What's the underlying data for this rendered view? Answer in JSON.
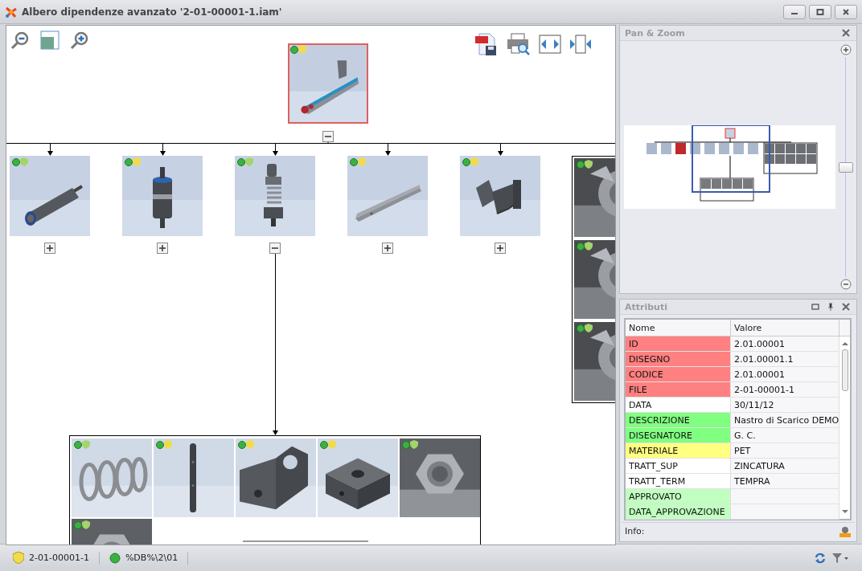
{
  "window": {
    "title": "Albero dipendenze avanzato '2-01-00001-1.iam'"
  },
  "tree": {
    "root": {
      "color": "#f0dc4a",
      "selected": true,
      "expanded": true
    },
    "children": [
      {
        "color": "#a5d46a",
        "selected": false,
        "expanded": false
      },
      {
        "color": "#f0dc4a",
        "selected": false,
        "expanded": false
      },
      {
        "color": "#a5d46a",
        "selected": false,
        "expanded": true
      },
      {
        "color": "#f0dc4a",
        "selected": false,
        "expanded": false
      },
      {
        "color": "#f0dc4a",
        "selected": false,
        "expanded": false
      }
    ],
    "side_group": [
      {
        "color": "#a5d46a"
      },
      {
        "color": "#a5d46a"
      },
      {
        "color": "#a5d46a"
      }
    ],
    "sub_group": [
      {
        "color": "#a5d46a"
      },
      {
        "color": "#f0dc4a"
      },
      {
        "color": "#f0dc4a"
      },
      {
        "color": "#f0dc4a"
      },
      {
        "color": "#a5d46a"
      },
      {
        "color": "#a5d46a"
      }
    ]
  },
  "panzoom": {
    "title": "Pan & Zoom",
    "level": 0.5
  },
  "attributes": {
    "title": "Attributi",
    "columns": [
      "Nome",
      "Valore"
    ],
    "rows": [
      {
        "name": "ID",
        "value": "2.01.00001",
        "color": "#ff8080"
      },
      {
        "name": "DISEGNO",
        "value": "2.01.00001.1",
        "color": "#ff8080"
      },
      {
        "name": "CODICE",
        "value": "2.01.00001",
        "color": "#ff8080"
      },
      {
        "name": "FILE",
        "value": "2-01-00001-1",
        "color": "#ff8080"
      },
      {
        "name": "DATA",
        "value": "30/11/12",
        "color": "#ffffff"
      },
      {
        "name": "DESCRIZIONE",
        "value": "Nastro di Scarico DEMO",
        "color": "#80ff80"
      },
      {
        "name": "DISEGNATORE",
        "value": "G. C.",
        "color": "#80ff80"
      },
      {
        "name": "MATERIALE",
        "value": "PET",
        "color": "#ffff80"
      },
      {
        "name": "TRATT_SUP",
        "value": "ZINCATURA",
        "color": "#ffffff"
      },
      {
        "name": "TRATT_TERM",
        "value": "TEMPRA",
        "color": "#ffffff"
      },
      {
        "name": "APPROVATO",
        "color": "#c0ffc0"
      },
      {
        "name": "DATA_APPROVAZIONE",
        "color": "#c0ffc0"
      }
    ],
    "info_label": "Info:"
  },
  "status_bar": [
    {
      "kind": "shield",
      "text": "2-01-00001-1"
    },
    {
      "kind": "dot",
      "text": "%DB%\\2\\01"
    }
  ]
}
